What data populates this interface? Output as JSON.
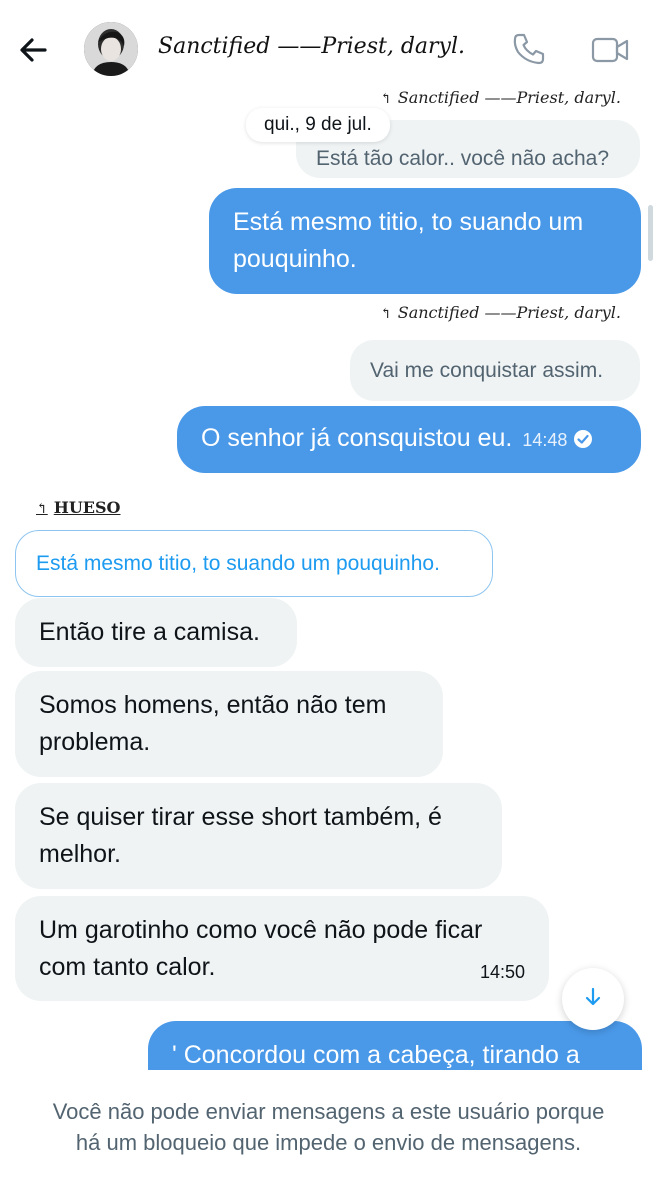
{
  "header": {
    "title": "Sanctified ——Priest, daryl.",
    "back_icon": "arrow-left-icon",
    "call_icon": "phone-icon",
    "video_icon": "video-camera-icon",
    "avatar_alt": "avatar"
  },
  "chat": {
    "date_separator": "qui., 9 de jul.",
    "messages": [
      {
        "reply_to": "Sanctified ——Priest, daryl.",
        "quote": "Está tão calor.. você não acha?"
      },
      {
        "text": "Está mesmo titio, to suando um pouquinho."
      },
      {
        "reply_to": "Sanctified ——Priest, daryl.",
        "quote": "Vai me conquistar assim."
      },
      {
        "text": "O senhor já consquistou eu.",
        "time": "14:48"
      },
      {
        "reply_to": "HUESO",
        "quote": "Está mesmo titio, to suando um pouquinho."
      },
      {
        "text": "Então tire a camisa."
      },
      {
        "text": "Somos homens, então não tem problema."
      },
      {
        "text": "Se quiser tirar esse short também, é melhor."
      },
      {
        "text": "Um garotinho como você não pode ficar com tanto calor.",
        "time": "14:50"
      },
      {
        "text": "' Concordou com a cabeça, tirando a"
      }
    ]
  },
  "footer": {
    "notice": "Você não pode enviar mensagens a este usuário porque há um bloqueio que impede o envio de mensagens."
  },
  "colors": {
    "accent": "#4a99e9",
    "incoming_bubble": "#eff3f4",
    "muted_text": "#536471"
  }
}
